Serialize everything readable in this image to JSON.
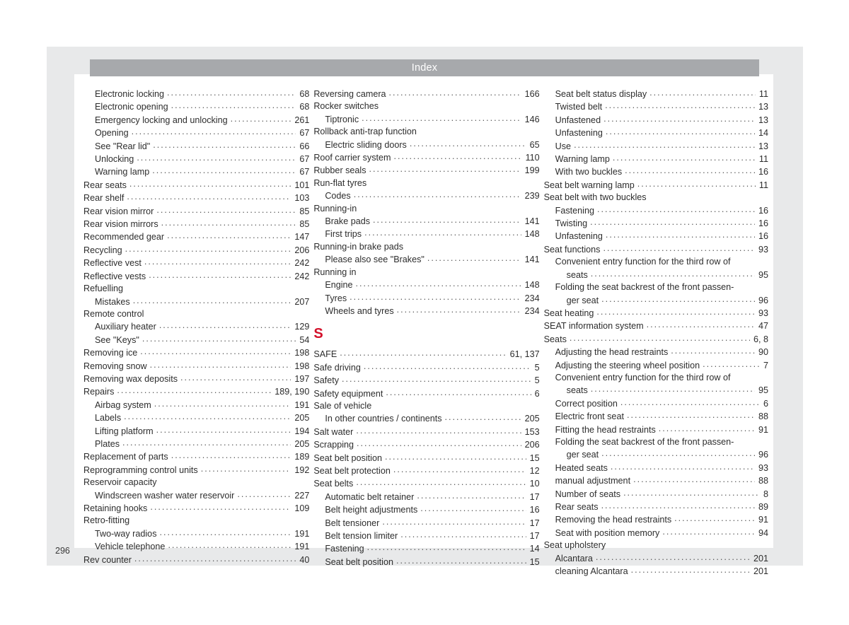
{
  "header": {
    "title": "Index"
  },
  "folio": {
    "page_number": "296"
  },
  "colors": {
    "header_bar": "#a7a9ac",
    "header_text": "#ffffff",
    "letter_heading": "#d3102a",
    "sheet": "#e8e9ea",
    "panel": "#ffffff",
    "body_text": "#2d2d2d"
  },
  "columns": [
    {
      "name": "column-1",
      "entries": [
        {
          "label": "Electronic locking",
          "page": "68",
          "level": 1
        },
        {
          "label": "Electronic opening",
          "page": "68",
          "level": 1
        },
        {
          "label": "Emergency locking and unlocking",
          "page": "261",
          "level": 1
        },
        {
          "label": "Opening",
          "page": "67",
          "level": 1
        },
        {
          "label": "See \"Rear lid\"",
          "page": "66",
          "level": 1
        },
        {
          "label": "Unlocking",
          "page": "67",
          "level": 1
        },
        {
          "label": "Warning lamp",
          "page": "67",
          "level": 1
        },
        {
          "label": "Rear seats",
          "page": "101",
          "level": 0
        },
        {
          "label": "Rear shelf",
          "page": "103",
          "level": 0
        },
        {
          "label": "Rear vision mirror",
          "page": "85",
          "level": 0
        },
        {
          "label": "Rear vision mirrors",
          "page": "85",
          "level": 0
        },
        {
          "label": "Recommended gear",
          "page": "147",
          "level": 0
        },
        {
          "label": "Recycling",
          "page": "206",
          "level": 0
        },
        {
          "label": "Reflective vest",
          "page": "242",
          "level": 0
        },
        {
          "label": "Reflective vests",
          "page": "242",
          "level": 0
        },
        {
          "label": "Refuelling",
          "page": "",
          "level": 0,
          "nodots": true
        },
        {
          "label": "Mistakes",
          "page": "207",
          "level": 1
        },
        {
          "label": "Remote control",
          "page": "",
          "level": 0,
          "nodots": true
        },
        {
          "label": "Auxiliary heater",
          "page": "129",
          "level": 1
        },
        {
          "label": "See \"Keys\"",
          "page": "54",
          "level": 1
        },
        {
          "label": "Removing ice",
          "page": "198",
          "level": 0
        },
        {
          "label": "Removing snow",
          "page": "198",
          "level": 0
        },
        {
          "label": "Removing wax deposits",
          "page": "197",
          "level": 0
        },
        {
          "label": "Repairs",
          "page": "189, 190",
          "level": 0
        },
        {
          "label": "Airbag system",
          "page": "191",
          "level": 1
        },
        {
          "label": "Labels",
          "page": "205",
          "level": 1
        },
        {
          "label": "Lifting platform",
          "page": "194",
          "level": 1
        },
        {
          "label": "Plates",
          "page": "205",
          "level": 1
        },
        {
          "label": "Replacement of parts",
          "page": "189",
          "level": 0
        },
        {
          "label": "Reprogramming control units",
          "page": "192",
          "level": 0
        },
        {
          "label": "Reservoir capacity",
          "page": "",
          "level": 0,
          "nodots": true
        },
        {
          "label": "Windscreen washer water reservoir",
          "page": "227",
          "level": 1
        },
        {
          "label": "Retaining hooks",
          "page": "109",
          "level": 0
        },
        {
          "label": "Retro-fitting",
          "page": "",
          "level": 0,
          "nodots": true
        },
        {
          "label": "Two-way radios",
          "page": "191",
          "level": 1
        },
        {
          "label": "Vehicle telephone",
          "page": "191",
          "level": 1
        },
        {
          "label": "Rev counter",
          "page": "40",
          "level": 0
        }
      ]
    },
    {
      "name": "column-2",
      "entries": [
        {
          "label": "Reversing camera",
          "page": "166",
          "level": 0
        },
        {
          "label": "Rocker switches",
          "page": "",
          "level": 0,
          "nodots": true
        },
        {
          "label": "Tiptronic",
          "page": "146",
          "level": 1
        },
        {
          "label": "Rollback anti-trap function",
          "page": "",
          "level": 0,
          "nodots": true
        },
        {
          "label": "Electric sliding doors",
          "page": "65",
          "level": 1
        },
        {
          "label": "Roof carrier system",
          "page": "110",
          "level": 0
        },
        {
          "label": "Rubber seals",
          "page": "199",
          "level": 0
        },
        {
          "label": "Run-flat tyres",
          "page": "",
          "level": 0,
          "nodots": true
        },
        {
          "label": "Codes",
          "page": "239",
          "level": 1
        },
        {
          "label": "Running-in",
          "page": "",
          "level": 0,
          "nodots": true
        },
        {
          "label": "Brake pads",
          "page": "141",
          "level": 1
        },
        {
          "label": "First trips",
          "page": "148",
          "level": 1
        },
        {
          "label": "Running-in brake pads",
          "page": "",
          "level": 0,
          "nodots": true
        },
        {
          "label": "Please also see \"Brakes\"",
          "page": "141",
          "level": 1
        },
        {
          "label": "Running in",
          "page": "",
          "level": 0,
          "nodots": true
        },
        {
          "label": "Engine",
          "page": "148",
          "level": 1
        },
        {
          "label": "Tyres",
          "page": "234",
          "level": 1
        },
        {
          "label": "Wheels and tyres",
          "page": "234",
          "level": 1
        },
        {
          "letter": "S"
        },
        {
          "label": "SAFE",
          "page": "61, 137",
          "level": 0
        },
        {
          "label": "Safe driving",
          "page": "5",
          "level": 0
        },
        {
          "label": "Safety",
          "page": "5",
          "level": 0
        },
        {
          "label": "Safety equipment",
          "page": "6",
          "level": 0
        },
        {
          "label": "Sale of vehicle",
          "page": "",
          "level": 0,
          "nodots": true
        },
        {
          "label": "In other countries / continents",
          "page": "205",
          "level": 1
        },
        {
          "label": "Salt water",
          "page": "153",
          "level": 0
        },
        {
          "label": "Scrapping",
          "page": "206",
          "level": 0
        },
        {
          "label": "Seat belt position",
          "page": "15",
          "level": 0
        },
        {
          "label": "Seat belt protection",
          "page": "12",
          "level": 0
        },
        {
          "label": "Seat belts",
          "page": "10",
          "level": 0
        },
        {
          "label": "Automatic belt retainer",
          "page": "17",
          "level": 1
        },
        {
          "label": "Belt height adjustments",
          "page": "16",
          "level": 1
        },
        {
          "label": "Belt tensioner",
          "page": "17",
          "level": 1
        },
        {
          "label": "Belt tension limiter",
          "page": "17",
          "level": 1
        },
        {
          "label": "Fastening",
          "page": "14",
          "level": 1
        },
        {
          "label": "Seat belt position",
          "page": "15",
          "level": 1
        }
      ]
    },
    {
      "name": "column-3",
      "entries": [
        {
          "label": "Seat belt status display",
          "page": "11",
          "level": 1
        },
        {
          "label": "Twisted belt",
          "page": "13",
          "level": 1
        },
        {
          "label": "Unfastened",
          "page": "13",
          "level": 1
        },
        {
          "label": "Unfastening",
          "page": "14",
          "level": 1
        },
        {
          "label": "Use",
          "page": "13",
          "level": 1
        },
        {
          "label": "Warning lamp",
          "page": "11",
          "level": 1
        },
        {
          "label": "With two buckles",
          "page": "16",
          "level": 1
        },
        {
          "label": "Seat belt warning lamp",
          "page": "11",
          "level": 0
        },
        {
          "label": "Seat belt with two buckles",
          "page": "",
          "level": 0,
          "nodots": true
        },
        {
          "label": "Fastening",
          "page": "16",
          "level": 1
        },
        {
          "label": "Twisting",
          "page": "16",
          "level": 1
        },
        {
          "label": "Unfastening",
          "page": "16",
          "level": 1
        },
        {
          "label": "Seat functions",
          "page": "93",
          "level": 0
        },
        {
          "label": "Convenient entry function for the third row of",
          "page": "",
          "level": 1,
          "wrapfirst": true
        },
        {
          "label": "seats",
          "page": "95",
          "level": 1,
          "continuation": true
        },
        {
          "label": "Folding the seat backrest of the front passen-",
          "page": "",
          "level": 1,
          "wrapfirst": true
        },
        {
          "label": "ger seat",
          "page": "96",
          "level": 1,
          "continuation": true
        },
        {
          "label": "Seat heating",
          "page": "93",
          "level": 0
        },
        {
          "label": "SEAT information system",
          "page": "47",
          "level": 0
        },
        {
          "label": "Seats",
          "page": "6, 8",
          "level": 0
        },
        {
          "label": "Adjusting the head restraints",
          "page": "90",
          "level": 1
        },
        {
          "label": "Adjusting the steering wheel position",
          "page": "7",
          "level": 1
        },
        {
          "label": "Convenient entry function for the third row of",
          "page": "",
          "level": 1,
          "wrapfirst": true
        },
        {
          "label": "seats",
          "page": "95",
          "level": 1,
          "continuation": true
        },
        {
          "label": "Correct position",
          "page": "6",
          "level": 1
        },
        {
          "label": "Electric front seat",
          "page": "88",
          "level": 1
        },
        {
          "label": "Fitting the head restraints",
          "page": "91",
          "level": 1
        },
        {
          "label": "Folding the seat backrest of the front passen-",
          "page": "",
          "level": 1,
          "wrapfirst": true
        },
        {
          "label": "ger seat",
          "page": "96",
          "level": 1,
          "continuation": true
        },
        {
          "label": "Heated seats",
          "page": "93",
          "level": 1
        },
        {
          "label": "manual adjustment",
          "page": "88",
          "level": 1
        },
        {
          "label": "Number of seats",
          "page": "8",
          "level": 1
        },
        {
          "label": "Rear seats",
          "page": "89",
          "level": 1
        },
        {
          "label": "Removing the head restraints",
          "page": "91",
          "level": 1
        },
        {
          "label": "Seat with position memory",
          "page": "94",
          "level": 1
        },
        {
          "label": "Seat upholstery",
          "page": "",
          "level": 0,
          "nodots": true
        },
        {
          "label": "Alcantara",
          "page": "201",
          "level": 1
        },
        {
          "label": "cleaning Alcantara",
          "page": "201",
          "level": 1
        }
      ]
    }
  ]
}
